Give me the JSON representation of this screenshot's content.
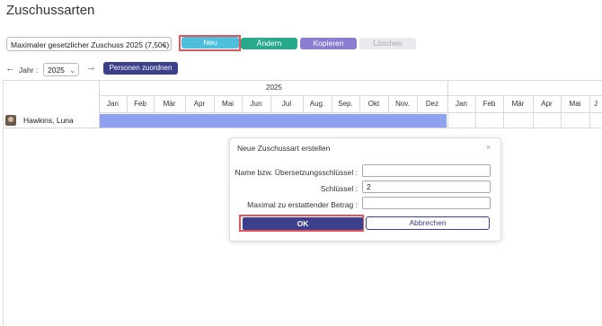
{
  "page": {
    "title": "Zuschussarten"
  },
  "toolbar": {
    "selected_zuschuss": "Maximaler gesetzlicher Zuschuss 2025 (7,50€)",
    "neu_label": "Neu",
    "aendern_label": "Ändern",
    "kopieren_label": "Kopieren",
    "loeschen_label": "Löschen",
    "colors": {
      "neu": "#4dbfdc",
      "aendern": "#27a98c",
      "kopieren": "#8b7dd2",
      "loeschen": "#e9e9ee",
      "highlight": "#e0545a"
    }
  },
  "year_nav": {
    "year_label": "Jahr :",
    "year_value": "2025",
    "personen_label": "Personen zuordnen"
  },
  "timeline": {
    "year": "2025",
    "months": [
      "Jan",
      "Feb",
      "Mär",
      "Apr",
      "Mai",
      "Jun",
      "Jul",
      "Aug.",
      "Sep.",
      "Okt",
      "Nov.",
      "Dez"
    ],
    "next_months": [
      "Jan",
      "Feb",
      "Mär",
      "Apr",
      "Mai",
      "J"
    ]
  },
  "person": {
    "name": "Hawkins, Luna"
  },
  "dialog": {
    "title": "Neue Zuschussart erstellen",
    "close": "×",
    "name_label": "Name bzw. Übersetzungsschlüssel :",
    "name_value": "",
    "key_label": "Schlüssel :",
    "key_value": "2",
    "max_label": "Maximal zu erstattender Betrag :",
    "max_value": "",
    "ok_label": "OK",
    "cancel_label": "Abbrechen"
  }
}
